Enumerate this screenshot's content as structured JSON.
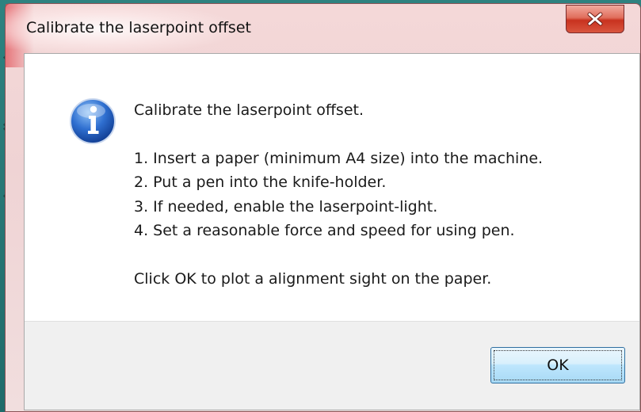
{
  "dialog": {
    "title": "Calibrate the laserpoint offset",
    "close_glyph": "×",
    "icon": "info-icon",
    "message": {
      "heading": "Calibrate the laserpoint offset.",
      "steps": [
        "1. Insert a paper (minimum A4 size) into the machine.",
        "2. Put a pen into the knife-holder.",
        "3. If needed, enable the laserpoint-light.",
        "4. Set a reasonable force and speed for using pen."
      ],
      "footer_note": "Click OK to plot a alignment sight on the paper."
    },
    "ok_label": "OK"
  },
  "colors": {
    "desktop": "#2e8280",
    "title_bar": "#f4d8d8",
    "close_button": "#c8321f",
    "ok_button": "#bee6fd"
  }
}
